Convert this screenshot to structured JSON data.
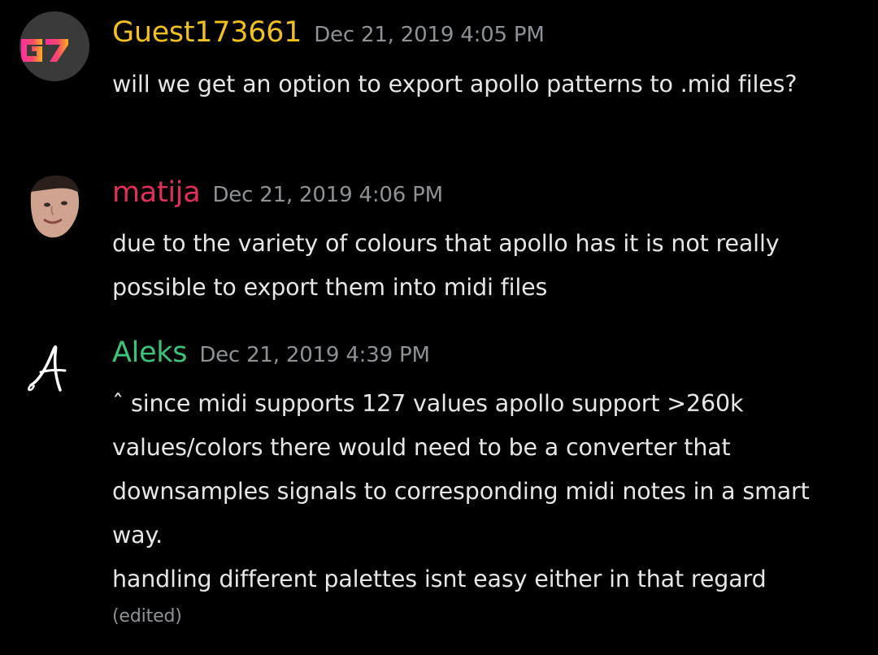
{
  "messages": [
    {
      "username": "Guest173661",
      "username_color": "#f0c020",
      "timestamp": "Dec 21, 2019 4:05 PM",
      "avatar_text": "G7",
      "lines": [
        "will we get an option to export apollo patterns to .mid files?"
      ]
    },
    {
      "username": "matija",
      "username_color": "#e0305a",
      "timestamp": "Dec 21, 2019 4:06 PM",
      "lines": [
        "due to the variety of colours that apollo has it is not really possible to export them into midi files"
      ]
    },
    {
      "username": "Aleks",
      "username_color": "#3cc27a",
      "timestamp": "Dec 21, 2019 4:39 PM",
      "avatar_text": "A",
      "lines": [
        "ˆ since midi supports 127 values apollo support >260k values/colors there would need to be a converter that downsamples signals to corresponding midi notes in a smart way.",
        "handling different palettes isnt easy either in that regard"
      ],
      "edited": "(edited)"
    }
  ]
}
